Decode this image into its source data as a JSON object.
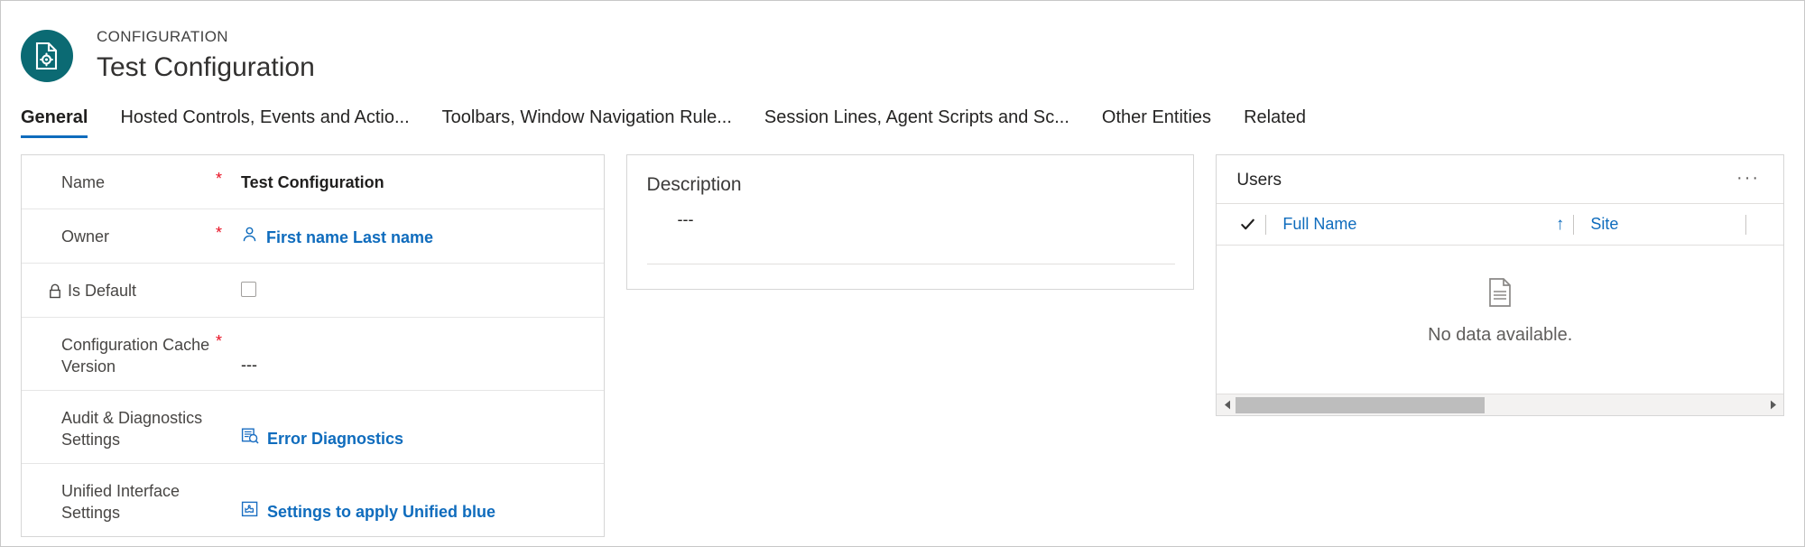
{
  "header": {
    "eyebrow": "CONFIGURATION",
    "title": "Test Configuration",
    "icon": "configuration-document-gear-icon",
    "icon_bg": "#0b6a73"
  },
  "tabs": [
    {
      "label": "General",
      "active": true
    },
    {
      "label": "Hosted Controls, Events and Actio...",
      "active": false
    },
    {
      "label": "Toolbars, Window Navigation Rule...",
      "active": false
    },
    {
      "label": "Session Lines, Agent Scripts and Sc...",
      "active": false
    },
    {
      "label": "Other Entities",
      "active": false
    },
    {
      "label": "Related",
      "active": false
    }
  ],
  "form": {
    "rows": [
      {
        "label": "Name",
        "required": "*",
        "value": "Test Configuration",
        "type": "text",
        "locked": false
      },
      {
        "label": "Owner",
        "required": "*",
        "value": "First name Last name",
        "type": "lookup",
        "icon": "person-icon",
        "locked": false
      },
      {
        "label": "Is Default",
        "required": "",
        "value": "",
        "type": "checkbox",
        "checked": false,
        "locked": true,
        "icon": "lock-icon"
      },
      {
        "label": "Configuration Cache Version",
        "required": "*",
        "value": "---",
        "type": "text",
        "locked": false
      },
      {
        "label": "Audit & Diagnostics Settings",
        "required": "",
        "value": "Error Diagnostics",
        "type": "link",
        "icon": "error-diagnostics-icon",
        "locked": false
      },
      {
        "label": "Unified Interface Settings",
        "required": "",
        "value": "Settings to apply Unified blue",
        "type": "link",
        "icon": "unified-interface-settings-icon",
        "locked": false
      }
    ]
  },
  "description": {
    "label": "Description",
    "value": "---"
  },
  "users": {
    "title": "Users",
    "overflow_label": "···",
    "columns": [
      {
        "label": "Full Name",
        "sort": "↑"
      },
      {
        "label": "Site",
        "sort": ""
      }
    ],
    "rows": [],
    "empty_message": "No data available.",
    "empty_icon": "document-lines-icon",
    "select_all_icon": "checkmark-icon",
    "scroll_left_icon": "◂",
    "scroll_right_icon": "▸"
  },
  "colors": {
    "accent": "#0f6cbd",
    "brand_teal": "#0b6a73",
    "required_red": "#e81123",
    "border": "#d6d6d6"
  }
}
